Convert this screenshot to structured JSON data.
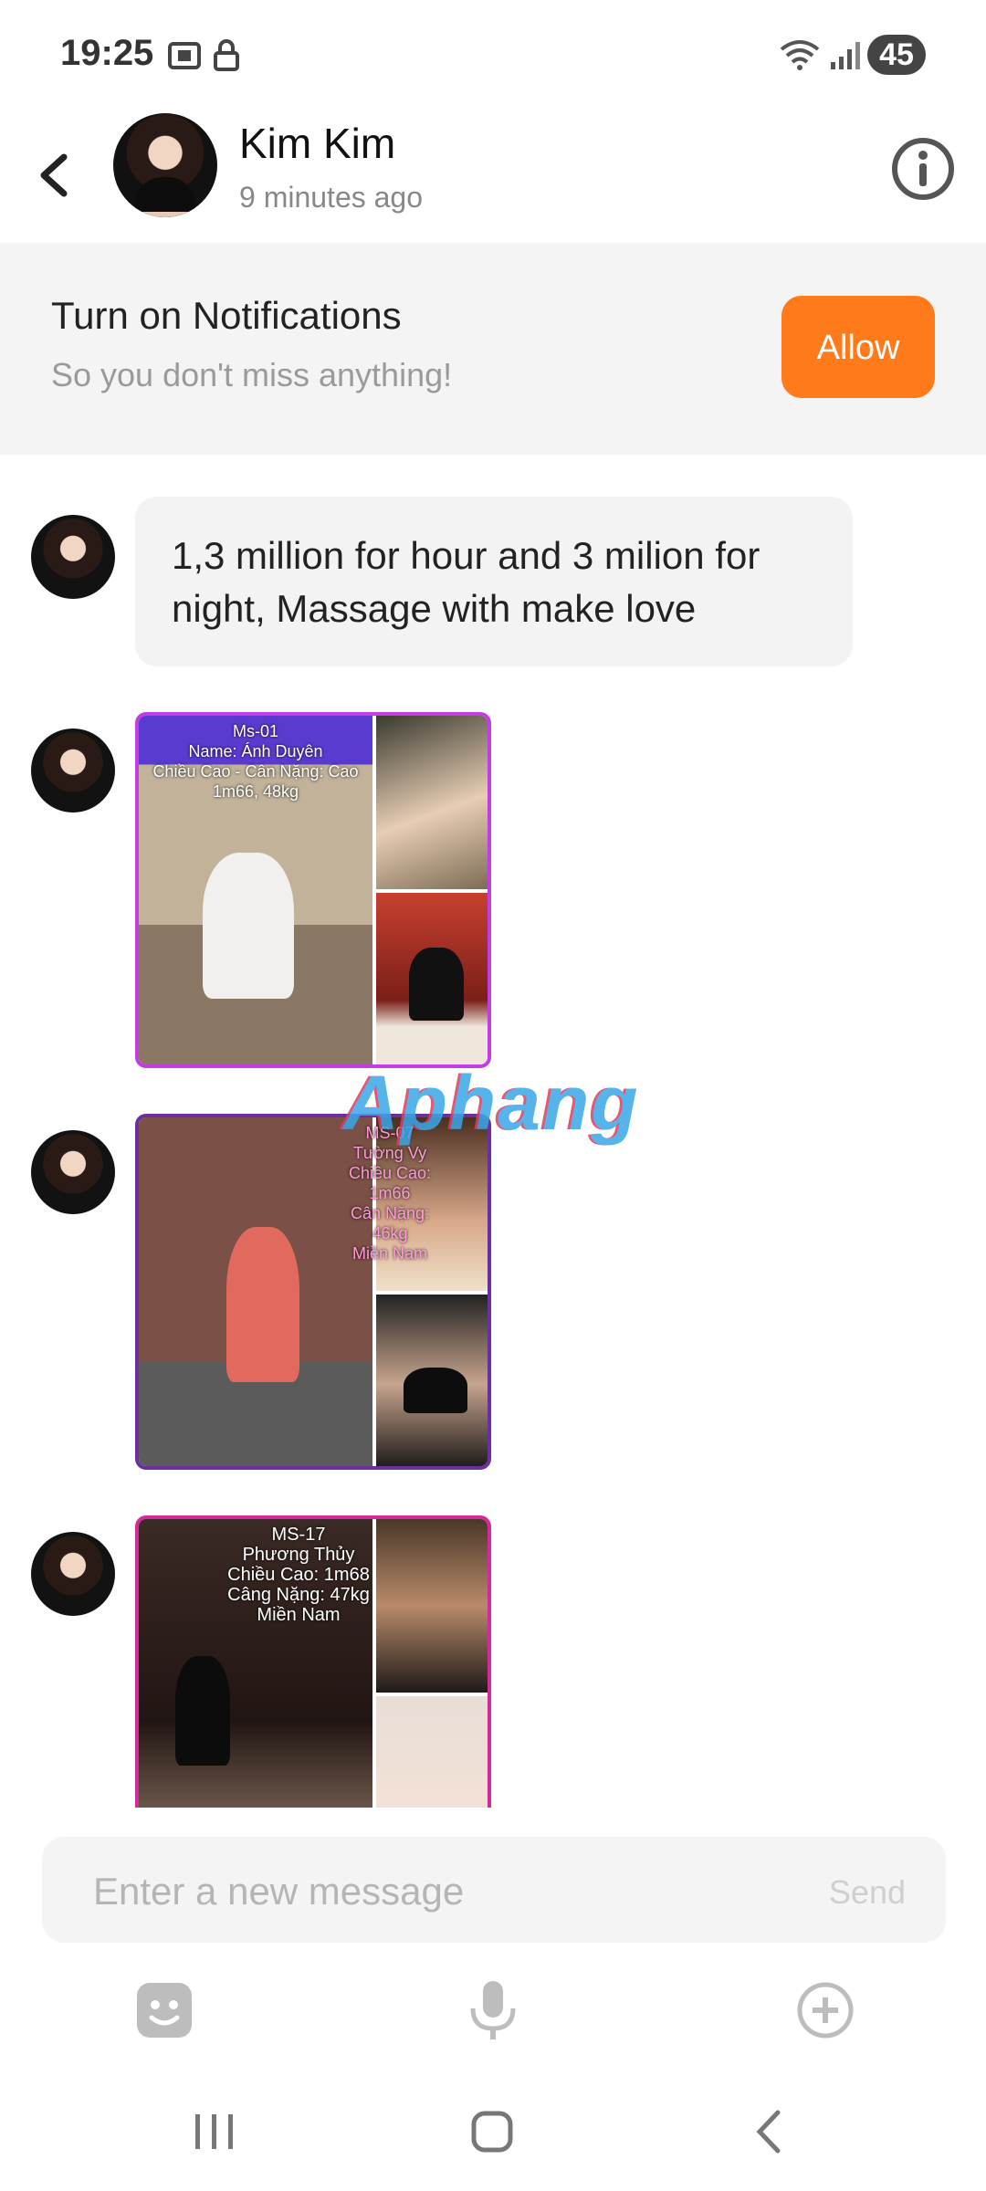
{
  "status_bar": {
    "time": "19:25",
    "battery": "45"
  },
  "header": {
    "name": "Kim Kim",
    "last_seen": "9 minutes ago"
  },
  "notification": {
    "title": "Turn on Notifications",
    "subtitle": "So you don't miss anything!",
    "allow_label": "Allow",
    "accent": "#ff7a1a"
  },
  "messages": [
    {
      "type": "text",
      "text": "1,3 million for hour and 3 milion for night, Massage with make love"
    },
    {
      "type": "image",
      "caption": "Ms-01\nName: Ánh Duyên\nChiều Cao - Cân Nặng: Cao 1m66, 48kg"
    },
    {
      "type": "image",
      "caption": "MS-07\nTường Vy\nChiều Cao: 1m66\nCân Nặng: 46kg\nMiền Nam"
    },
    {
      "type": "image",
      "caption": "MS-17\nPhương Thủy\nChiều Cao: 1m68\nCâng Nặng: 47kg\nMiền Nam"
    }
  ],
  "watermark": "Aphang",
  "composer": {
    "placeholder": "Enter a new message",
    "send_label": "Send"
  },
  "icons": [
    "back-arrow-icon",
    "info-icon",
    "emoji-icon",
    "microphone-icon",
    "plus-circle-icon",
    "recent-apps-icon",
    "home-icon",
    "nav-back-icon"
  ]
}
